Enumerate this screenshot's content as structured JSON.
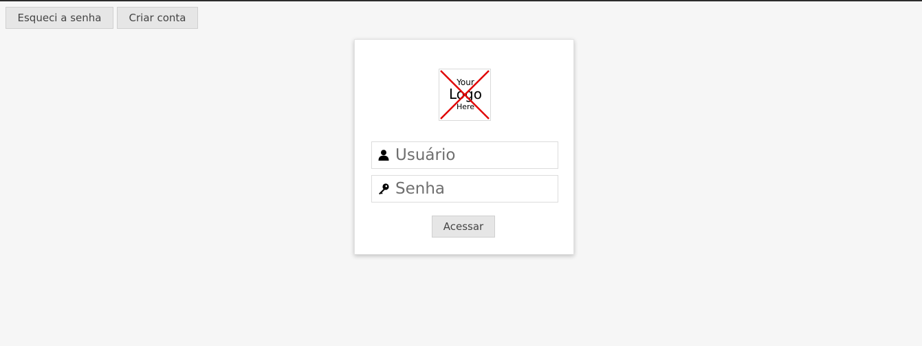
{
  "top_nav": {
    "forgot_password_label": "Esqueci a senha",
    "create_account_label": "Criar conta"
  },
  "login_card": {
    "logo": {
      "line1": "Your",
      "line2": "Logo",
      "line3": "Here",
      "icon": "logo-placeholder-icon"
    },
    "username": {
      "placeholder": "Usuário",
      "value": "",
      "icon": "user-icon"
    },
    "password": {
      "placeholder": "Senha",
      "value": "",
      "icon": "key-icon"
    },
    "submit_label": "Acessar"
  },
  "colors": {
    "background": "#f6f6f6",
    "card": "#ffffff",
    "button": "#e6e6e6",
    "logo_cross": "#e00000"
  }
}
